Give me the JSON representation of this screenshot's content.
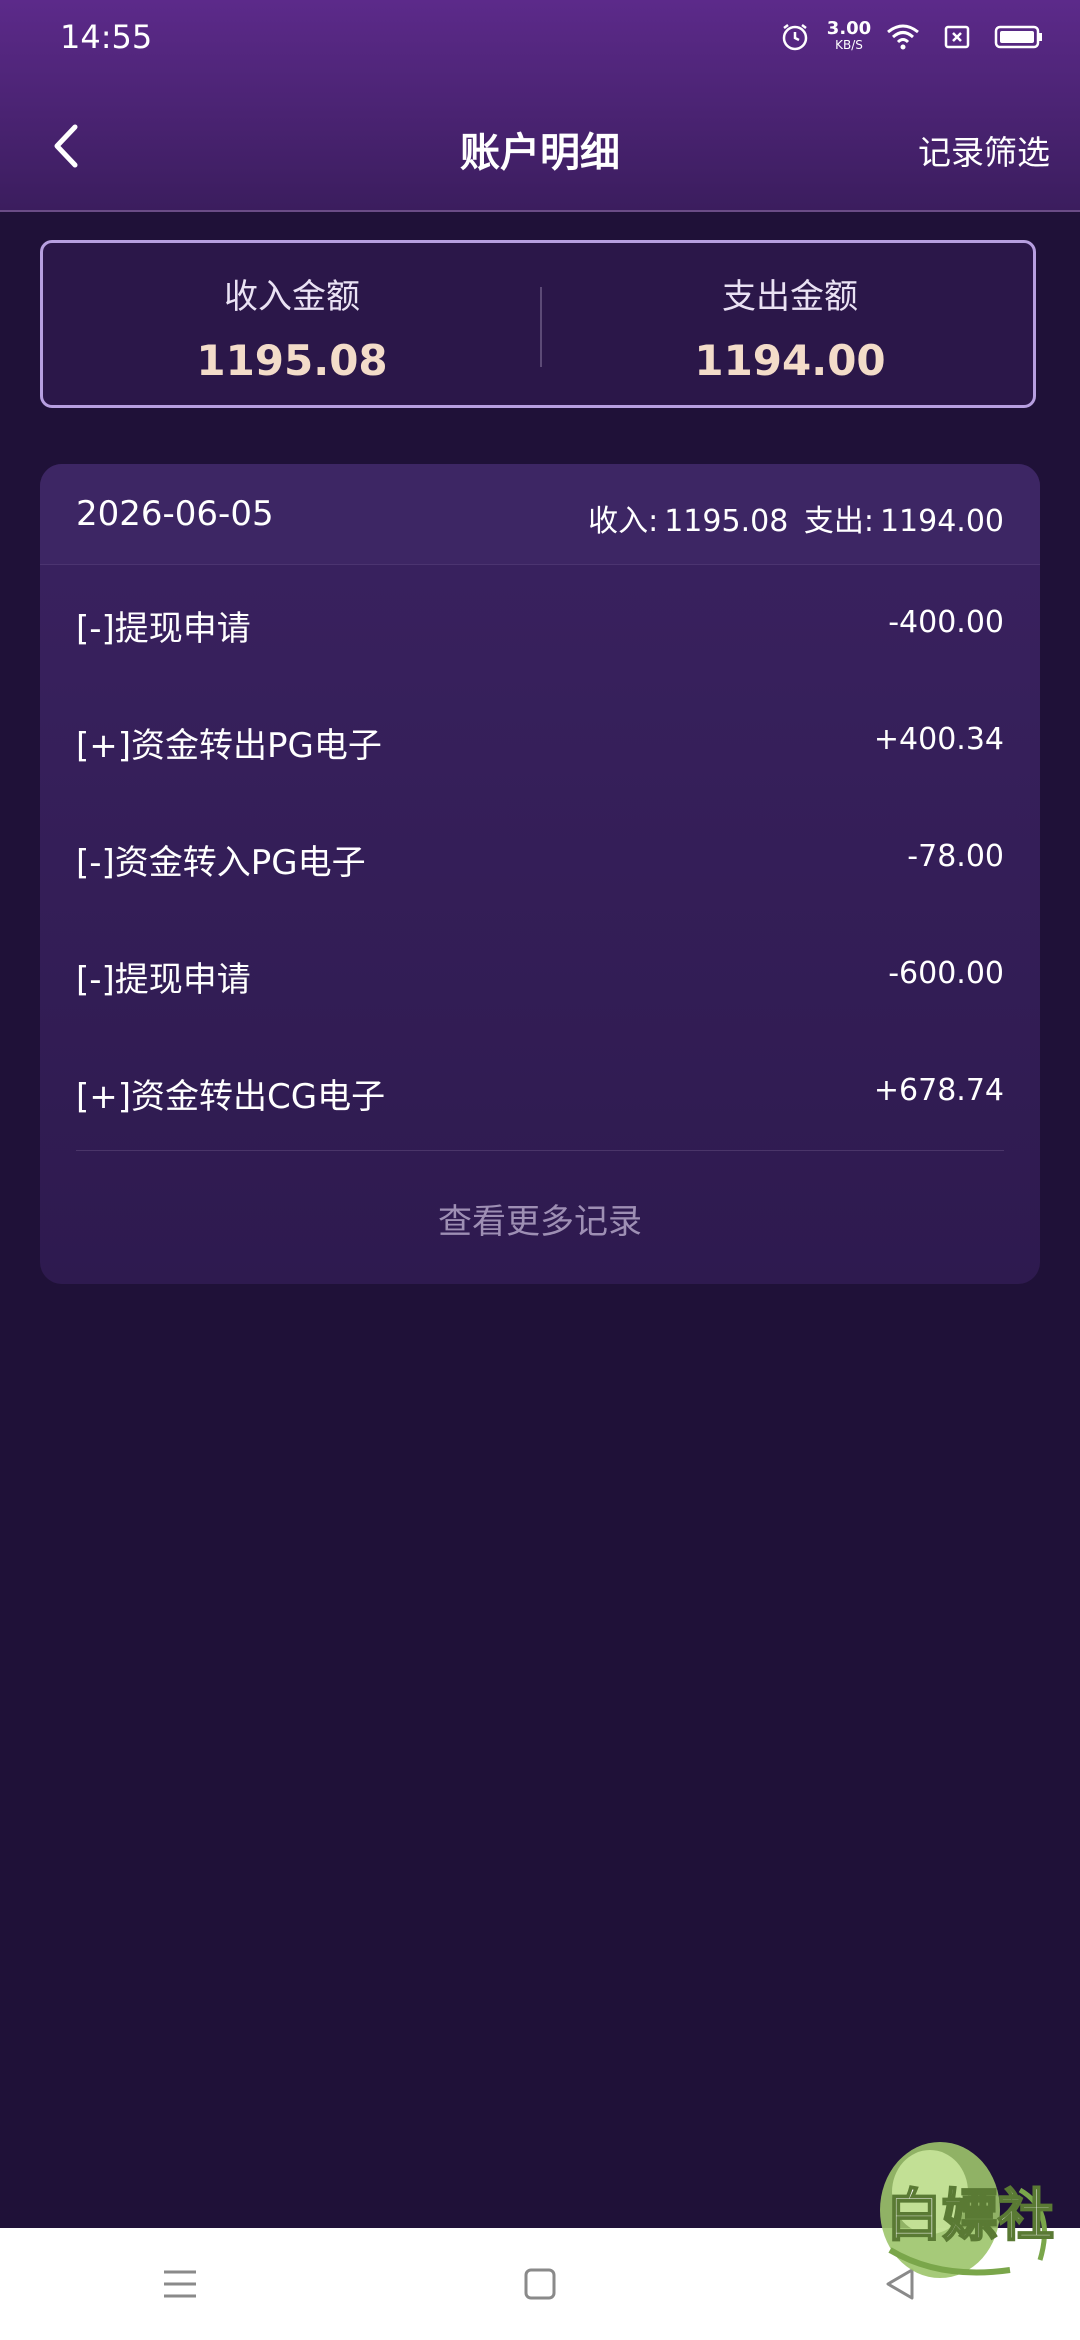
{
  "status_bar": {
    "time": "14:55",
    "speed_value": "3.00",
    "speed_unit": "KB/S",
    "icons": [
      "alarm-icon",
      "wifi-icon",
      "sim-disabled-icon",
      "battery-icon"
    ]
  },
  "nav": {
    "title": "账户明细",
    "filter_label": "记录筛选",
    "back_icon": "chevron-left-icon"
  },
  "summary": {
    "income_label": "收入金额",
    "income_value": "1195.08",
    "expense_label": "支出金额",
    "expense_value": "1194.00"
  },
  "records": {
    "date": "2026-06-05",
    "income_label": "收入:",
    "income_total": "1195.08",
    "expense_label": "支出:",
    "expense_total": "1194.00",
    "items": [
      {
        "name": "[-]提现申请",
        "amount": "-400.00"
      },
      {
        "name": "[+]资金转出PG电子",
        "amount": "+400.34"
      },
      {
        "name": "[-]资金转入PG电子",
        "amount": "-78.00"
      },
      {
        "name": "[-]提现申请",
        "amount": "-600.00"
      },
      {
        "name": "[+]资金转出CG电子",
        "amount": "+678.74"
      }
    ],
    "more_label": "查看更多记录"
  },
  "watermark": {
    "text": "白嫖社"
  },
  "colors": {
    "header_top": "#5c2a8a",
    "background": "#1f1138",
    "card": "#2e1a4f",
    "summary_value": "#f3dcc9",
    "muted_text": "#9e8fb4"
  }
}
